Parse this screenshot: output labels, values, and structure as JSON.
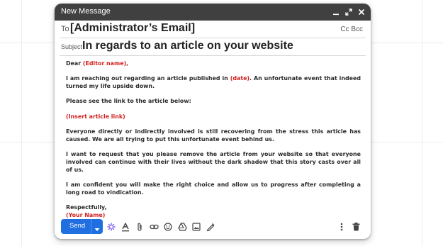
{
  "window": {
    "title": "New Message",
    "controls": [
      "minimize-icon",
      "expand-icon",
      "close-icon"
    ]
  },
  "to": {
    "label": "To",
    "value": "[Administrator’s Email]",
    "cc_bcc": "Cc Bcc"
  },
  "subject": {
    "label": "Subject",
    "value": "In regards to an article on your website"
  },
  "body": {
    "greeting": "Dear ",
    "editor_name": "(Editor name),",
    "p1_a": "I am reaching out regarding an article published in ",
    "date": "(date)",
    "p1_b": ". An unfortunate event that indeed turned my life upside down.",
    "p2": "Please see the link to the article below:",
    "link": "(Insert article link)",
    "p3": "Everyone directly or indirectly involved is still recovering from the stress this article has caused. We are all trying to put this unfortunate event behind us.",
    "p4": "I want to request that you please remove the article from your website so that everyone involved can continue with their lives without the dark shadow that this story casts over all of us.",
    "p5": "I am confident you will make the right choice and allow us to progress after completing a long road to vindication.",
    "closing": "Respectfully,",
    "your_name": "(Your Name)"
  },
  "footer": {
    "send_label": "Send",
    "icons": [
      "ai-sparkle-icon",
      "formatting-icon",
      "attach-icon",
      "link-icon",
      "emoji-icon",
      "drive-icon",
      "photo-icon",
      "signature-icon",
      "more-options-icon",
      "trash-icon"
    ]
  },
  "colors": {
    "titlebar": "#404040",
    "accent": "#1f6fe0",
    "placeholder": "#d21f1f",
    "text": "#2a2a2a"
  }
}
